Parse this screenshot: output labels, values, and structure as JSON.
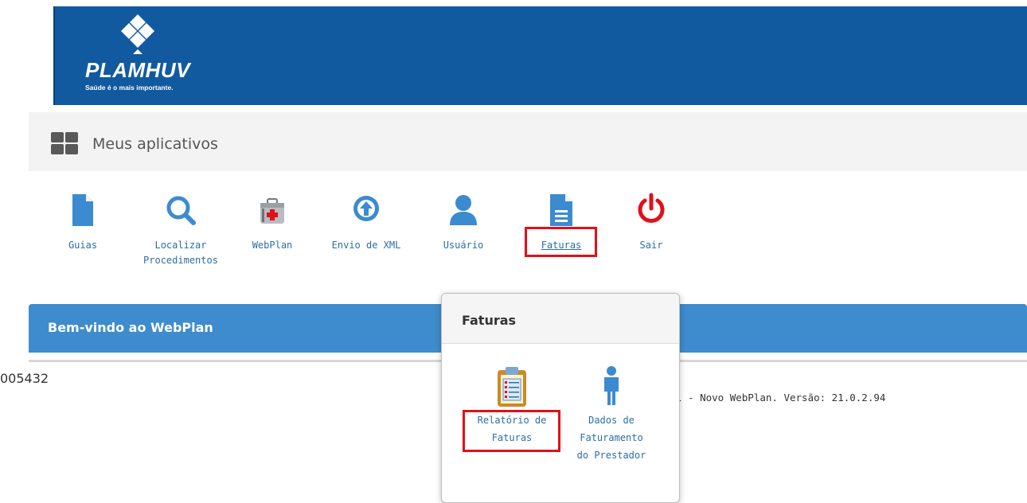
{
  "brand": {
    "name": "PLAMHUV",
    "tagline": "Saúde é o mais importante."
  },
  "apps": {
    "title": "Meus aplicativos",
    "items": [
      {
        "label_lines": [
          "Guias"
        ],
        "icon": "document-icon"
      },
      {
        "label_lines": [
          "Localizar",
          "Procedimentos"
        ],
        "icon": "search-icon"
      },
      {
        "label_lines": [
          "WebPlan"
        ],
        "icon": "medical-kit-icon"
      },
      {
        "label_lines": [
          "Envio de XML"
        ],
        "icon": "upload-icon"
      },
      {
        "label_lines": [
          "Usuário"
        ],
        "icon": "user-icon"
      },
      {
        "label_lines": [
          "Faturas"
        ],
        "icon": "invoice-icon"
      },
      {
        "label_lines": [
          "Sair"
        ],
        "icon": "power-icon"
      }
    ]
  },
  "welcome": {
    "title": "Bem-vindo ao WebPlan",
    "code": "005432",
    "version": "l - Novo WebPlan. Versão: 21.0.2.94"
  },
  "popover": {
    "title": "Faturas",
    "items": [
      {
        "label_lines": [
          "Relatório de",
          "Faturas"
        ],
        "icon": "clipboard-report-icon"
      },
      {
        "label_lines": [
          "Dados de",
          "Faturamento",
          "do Prestador"
        ],
        "icon": "person-icon"
      }
    ]
  },
  "colors": {
    "banner": "#125aa0",
    "welcome_bar": "#3e8ccd",
    "icon_blue": "#3c8bd1",
    "power_red": "#e0101b",
    "highlight": "#e0101b",
    "link": "#2c6ea7"
  }
}
